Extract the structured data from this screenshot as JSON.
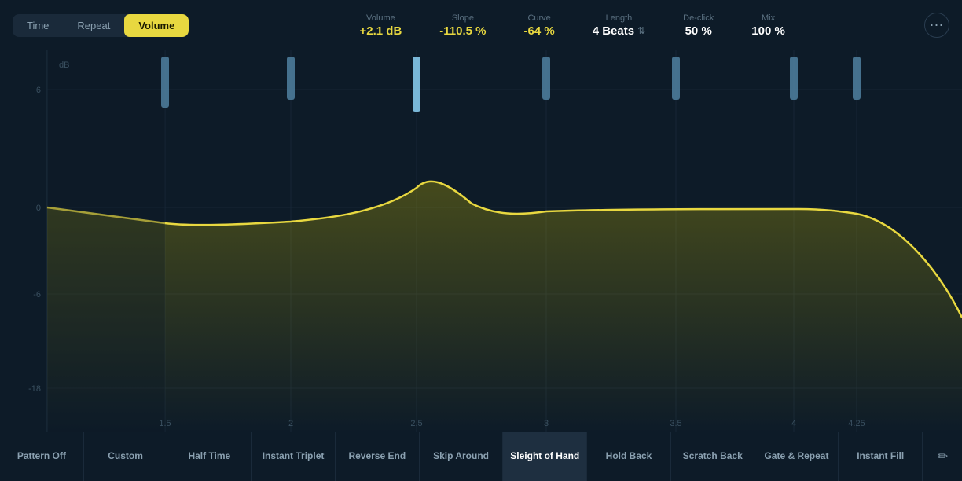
{
  "header": {
    "tabs": [
      {
        "id": "time",
        "label": "Time",
        "active": false
      },
      {
        "id": "repeat",
        "label": "Repeat",
        "active": false
      },
      {
        "id": "volume",
        "label": "Volume",
        "active": true
      }
    ],
    "params": {
      "volume": {
        "label": "Volume",
        "value": "+2.1 dB",
        "yellow": true
      },
      "slope": {
        "label": "Slope",
        "value": "-110.5 %",
        "yellow": true
      },
      "curve": {
        "label": "Curve",
        "value": "-64 %",
        "yellow": true
      },
      "length": {
        "label": "Length",
        "value": "4 Beats"
      },
      "declick": {
        "label": "De-click",
        "value": "50 %"
      },
      "mix": {
        "label": "Mix",
        "value": "100 %"
      }
    }
  },
  "chart": {
    "y_labels": [
      "6",
      "0",
      "-6",
      "-18"
    ],
    "x_labels": [
      {
        "value": "1.5",
        "pct": 12
      },
      {
        "value": "2",
        "pct": 25
      },
      {
        "value": "2.5",
        "pct": 38
      },
      {
        "value": "3",
        "pct": 51
      },
      {
        "value": "3.5",
        "pct": 64
      },
      {
        "value": "4",
        "pct": 77
      },
      {
        "value": "4.25",
        "pct": 85
      }
    ],
    "db_label": "dB",
    "handle_positions": [
      12,
      25,
      38,
      51,
      64,
      77,
      85
    ]
  },
  "bottom_tabs": [
    {
      "id": "pattern-off",
      "label": "Pattern Off",
      "active": false
    },
    {
      "id": "custom",
      "label": "Custom",
      "active": false
    },
    {
      "id": "half-time",
      "label": "Half Time",
      "active": false
    },
    {
      "id": "instant-triplet",
      "label": "Instant Triplet",
      "active": false
    },
    {
      "id": "reverse-end",
      "label": "Reverse End",
      "active": false
    },
    {
      "id": "skip-around",
      "label": "Skip Around",
      "active": false
    },
    {
      "id": "sleight-of-hand",
      "label": "Sleight of Hand",
      "active": true
    },
    {
      "id": "hold-back",
      "label": "Hold Back",
      "active": false
    },
    {
      "id": "scratch-back",
      "label": "Scratch Back",
      "active": false
    },
    {
      "id": "gate-repeat",
      "label": "Gate & Repeat",
      "active": false
    },
    {
      "id": "instant-fill",
      "label": "Instant Fill",
      "active": false
    }
  ],
  "icons": {
    "more": "⋯",
    "chevron_up_down": "⇅",
    "pencil": "✏"
  }
}
